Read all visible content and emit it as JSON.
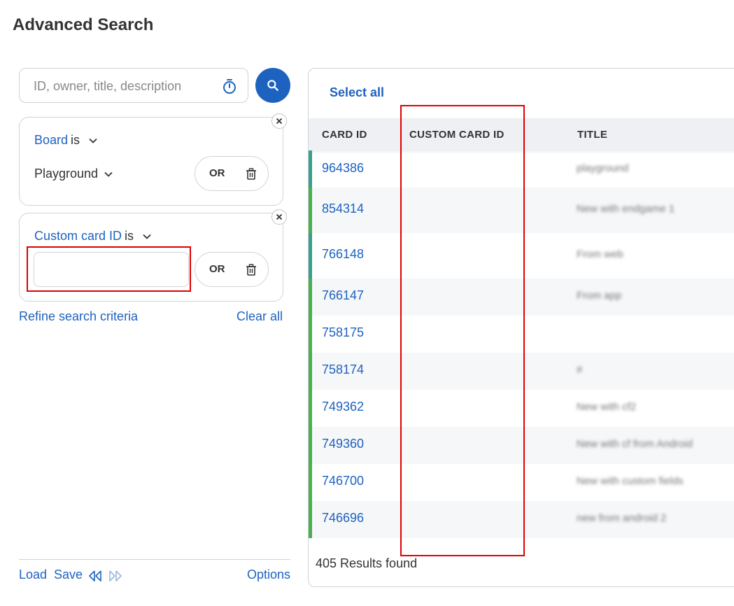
{
  "page": {
    "title": "Advanced Search"
  },
  "search": {
    "placeholder": "ID, owner, title, description"
  },
  "filters": [
    {
      "field": "Board",
      "op": "is",
      "value": "Playground",
      "or_label": "OR"
    },
    {
      "field": "Custom card ID",
      "op": "is",
      "value": "",
      "or_label": "OR"
    }
  ],
  "links": {
    "refine": "Refine search criteria",
    "clear_all": "Clear all"
  },
  "footer": {
    "load": "Load",
    "save": "Save",
    "options": "Options"
  },
  "results": {
    "select_all": "Select all",
    "columns": [
      "CARD ID",
      "CUSTOM CARD ID",
      "TITLE"
    ],
    "rows": [
      {
        "id": "964386",
        "custom": "",
        "title": "playground"
      },
      {
        "id": "854314",
        "custom": "",
        "title": "New with endgame 1"
      },
      {
        "id": "766148",
        "custom": "",
        "title": "From web"
      },
      {
        "id": "766147",
        "custom": "",
        "title": "From app"
      },
      {
        "id": "758175",
        "custom": "",
        "title": ""
      },
      {
        "id": "758174",
        "custom": "",
        "title": "#"
      },
      {
        "id": "749362",
        "custom": "",
        "title": "New with cf2"
      },
      {
        "id": "749360",
        "custom": "",
        "title": "New with cf from Android"
      },
      {
        "id": "746700",
        "custom": "",
        "title": "New with custom fields"
      },
      {
        "id": "746696",
        "custom": "",
        "title": "new from android 2"
      }
    ],
    "count_text": "405 Results found"
  },
  "colors": {
    "accent": "#1e62c0",
    "row_bar_green": "#4caf50",
    "row_bar_teal": "#3a9e8c",
    "highlight": "#e00000"
  }
}
